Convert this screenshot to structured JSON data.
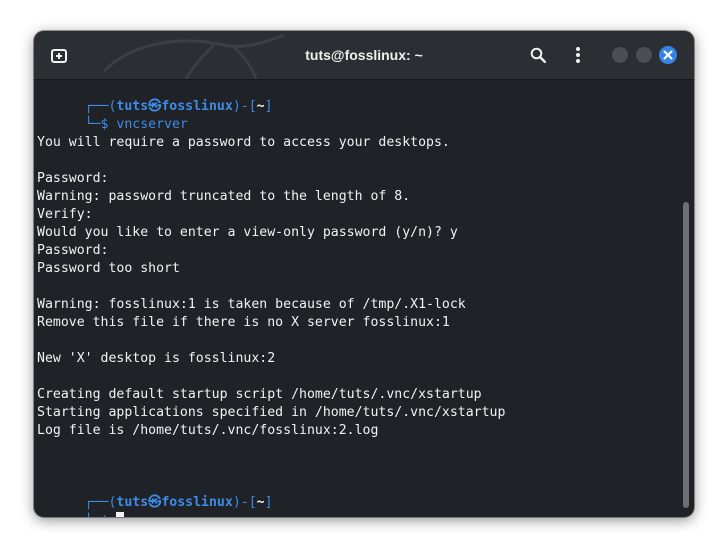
{
  "window": {
    "title": "tuts@fosslinux: ~"
  },
  "prompt": {
    "open_bracket": "┌──(",
    "user": "tuts",
    "at": "㉿",
    "host": "fosslinux",
    "mid": ")-[",
    "dir": "~",
    "close": "]",
    "arrow": "└─$ "
  },
  "first_command": "vncserver",
  "output": [
    "",
    "You will require a password to access your desktops.",
    "",
    "Password:",
    "Warning: password truncated to the length of 8.",
    "Verify:",
    "Would you like to enter a view-only password (y/n)? y",
    "Password:",
    "Password too short",
    "",
    "Warning: fosslinux:1 is taken because of /tmp/.X1-lock",
    "Remove this file if there is no X server fosslinux:1",
    "",
    "New 'X' desktop is fosslinux:2",
    "",
    "Creating default startup script /home/tuts/.vnc/xstartup",
    "Starting applications specified in /home/tuts/.vnc/xstartup",
    "Log file is /home/tuts/.vnc/fosslinux:2.log"
  ],
  "icons": {
    "new_tab": "new-tab-icon",
    "search": "search-icon",
    "menu": "kebab-menu-icon",
    "close": "close-icon"
  },
  "colors": {
    "accent": "#3f8be6",
    "close_button": "#3584e4",
    "terminal_bg": "#1f2227",
    "titlebar_bg": "#2b2e33"
  }
}
